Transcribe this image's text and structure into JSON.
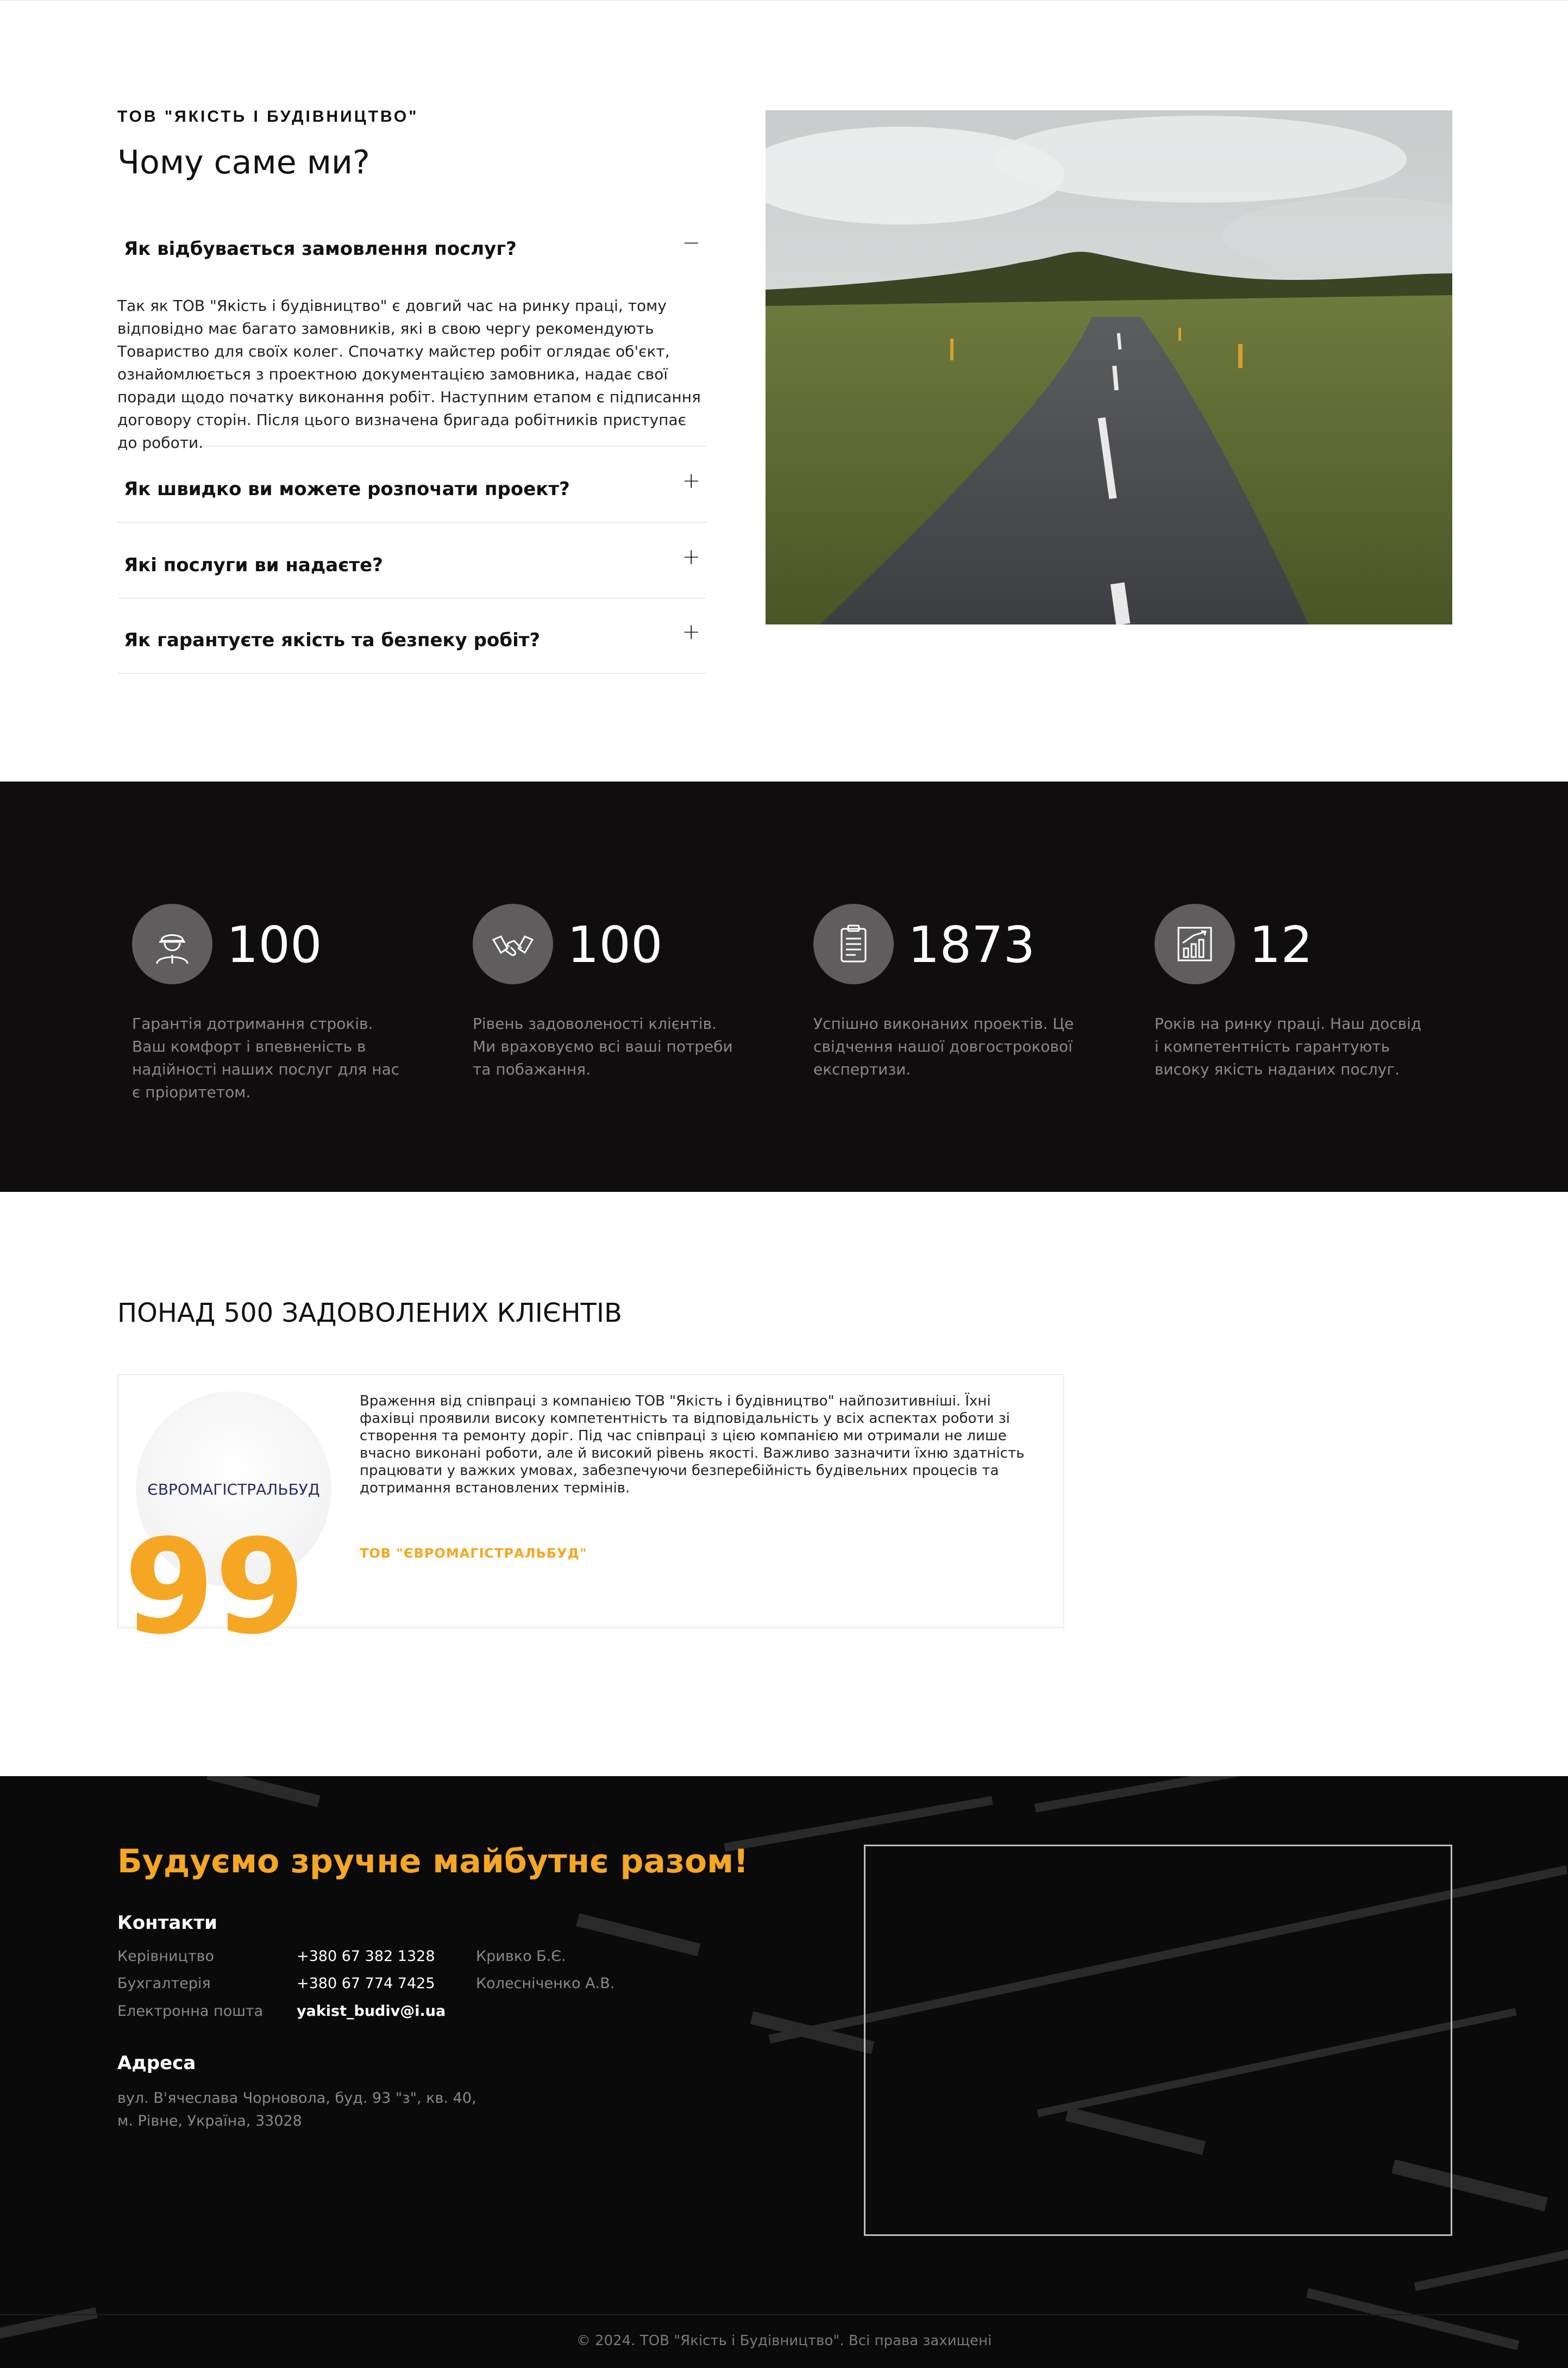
{
  "faq": {
    "eyebrow": "ТОВ \"ЯКІСТЬ І БУДІВНИЦТВО\"",
    "title": "Чому саме ми?",
    "items": [
      {
        "question": "Як відбувається замовлення послуг?",
        "toggle": "−",
        "expanded": true,
        "answer": "Так як ТОВ \"Якість і будівництво\" є довгий час на ринку праці, тому відповідно має багато замовників, які в свою чергу рекомендують Товариство для своїх колег. Спочатку майстер робіт оглядає об'єкт, ознайомлюється з проектною документацією замовника, надає свої поради щодо початку виконання робіт. Наступним етапом є підписання договору сторін. Після цього визначена бригада робітників приступає до роботи."
      },
      {
        "question": "Як швидко ви можете розпочати проект?",
        "toggle": "+",
        "expanded": false
      },
      {
        "question": "Які послуги ви надаєте?",
        "toggle": "+",
        "expanded": false
      },
      {
        "question": "Як гарантуєте якість та безпеку робіт?",
        "toggle": "+",
        "expanded": false
      }
    ]
  },
  "stats": [
    {
      "icon": "worker-helmet-icon",
      "value": "100",
      "description": "Гарантія дотримання строків. Ваш комфорт і впевненість в надійності наших послуг для нас є пріоритетом."
    },
    {
      "icon": "handshake-icon",
      "value": "100",
      "description": "Рівень задоволеності клієнтів. Ми враховуємо всі ваші потреби та побажання."
    },
    {
      "icon": "clipboard-icon",
      "value": "1873",
      "description": "Успішно виконаних проектів. Це свідчення нашої довгострокової експертизи."
    },
    {
      "icon": "growth-chart-icon",
      "value": "12",
      "description": "Років на ринку праці. Наш досвід і компетентність гарантують високу якість наданих послуг."
    }
  ],
  "testimonials": {
    "heading": "ПОНАД 500 ЗАДОВОЛЕНИХ КЛІЄНТІВ",
    "items": [
      {
        "logo_text": "ЄВРОМАГІСТРАЛЬБУД",
        "quote_mark": "99",
        "text": "Враження від співпраці з компанією ТОВ \"Якість і будівництво\" найпозитивніші. Їхні фахівці проявили високу компетентність та відповідальність у всіх аспектах роботи зі створення та ремонту доріг. Під час співпраці з цією компанією ми отримали не лише вчасно виконані роботи, але й високий рівень якості. Важливо зазначити їхню здатність працювати у важких умовах, забезпечуючи безперебійність будівельних процесів та дотримання встановлених термінів.",
        "author": "ТОВ \"ЄВРОМАГІСТРАЛЬБУД\""
      }
    ]
  },
  "footer": {
    "title": "Будуємо зручне майбутнє разом!",
    "contacts_heading": "Контакти",
    "contacts": [
      {
        "label": "Керівництво",
        "value": "+380 67 382 1328",
        "name": "Кривко Б.Є."
      },
      {
        "label": "Бухгалтерія",
        "value": "+380 67 774 7425",
        "name": "Колесніченко А.В."
      },
      {
        "label": "Електронна пошта",
        "value": "yakist_budiv@i.ua",
        "name": ""
      }
    ],
    "address_heading": "Адреса",
    "address_line1": "вул. В'ячеслава Чорновола, буд. 93 \"з\", кв. 40,",
    "address_line2": "м. Рівне, Україна, 33028",
    "copyright": "© 2024. ТОВ \"Якість і Будівництво\". Всі права захищені"
  },
  "colors": {
    "accent": "#f5a623",
    "dark_bg": "#0f0d0e",
    "muted_text": "#8a8888"
  }
}
